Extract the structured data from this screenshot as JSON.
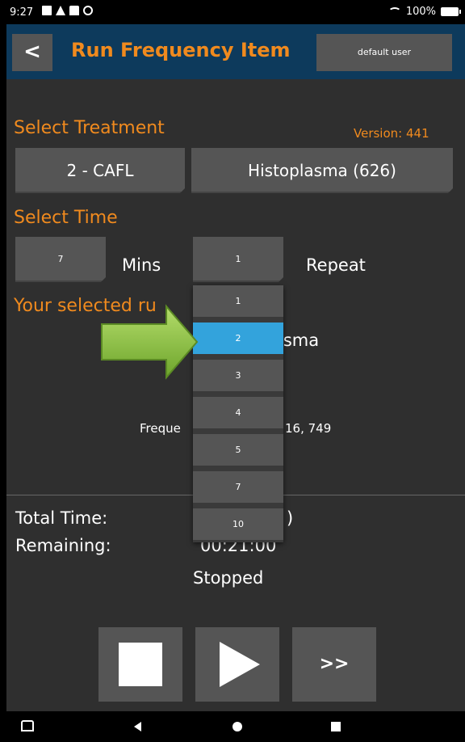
{
  "status_bar": {
    "time": "9:27",
    "battery": "100%",
    "icons": [
      "notification-icon",
      "warning-icon",
      "book-icon",
      "settings-icon",
      "wifi-icon",
      "battery-icon"
    ]
  },
  "header": {
    "back_label": "<",
    "title": "Run Frequency Item",
    "user_label": "default user"
  },
  "treatment": {
    "label": "Select Treatment",
    "version": "Version: 441",
    "program_button": "2 -  CAFL",
    "item_button": "Histoplasma (626)"
  },
  "time": {
    "label": "Select Time",
    "mins_value": "7",
    "mins_label": "Mins",
    "repeat_value": "1",
    "repeat_label": "Repeat"
  },
  "selected_run": {
    "label_visible": "Your selected ru",
    "name_fragment": "asma",
    "frequency_left": "Freque",
    "frequency_right": "16, 749"
  },
  "repeat_dropdown": {
    "options": [
      "1",
      "2",
      "3",
      "4",
      "5",
      "7",
      "10"
    ],
    "selected": "2"
  },
  "timing": {
    "total_label": "Total Time:",
    "total_value_fragment": ")",
    "remaining_label": "Remaining:",
    "remaining_value": "00:21:00",
    "status": "Stopped"
  },
  "controls": {
    "fast_forward_label": ">>"
  },
  "colors": {
    "accent_orange": "#f08a1e",
    "header_blue": "#0d3a5c",
    "selection_blue": "#33a3dc",
    "button_grey": "#555555",
    "background": "#2f2f2f",
    "arrow_green": "#8cc63f"
  }
}
